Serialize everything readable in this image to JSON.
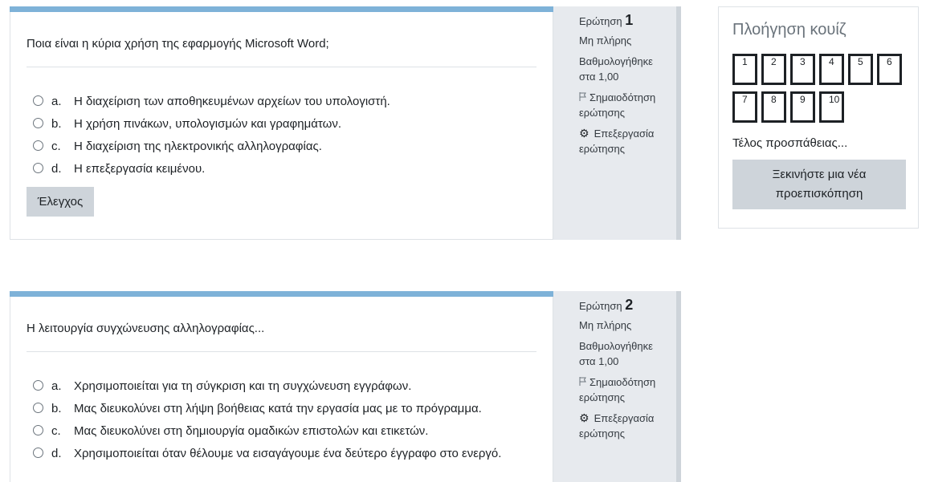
{
  "questions": [
    {
      "label": "Ερώτηση",
      "number": "1",
      "status": "Μη πλήρης",
      "grade_line1": "Βαθμολογήθηκε",
      "grade_line2": "στα 1,00",
      "flag_line1": "Σημαιοδότηση",
      "flag_line2": "ερώτησης",
      "edit_line1": "Επεξεργασία",
      "edit_line2": "ερώτησης",
      "text": "Ποια είναι η κύρια χρήση της εφαρμογής Microsoft Word;",
      "answers": [
        {
          "letter": "a.",
          "text": "Η διαχείριση των αποθηκευμένων αρχείων του υπολογιστή."
        },
        {
          "letter": "b.",
          "text": "Η χρήση πινάκων, υπολογισμών και γραφημάτων."
        },
        {
          "letter": "c.",
          "text": "Η διαχείριση της ηλεκτρονικής αλληλογραφίας."
        },
        {
          "letter": "d.",
          "text": "Η επεξεργασία κειμένου."
        }
      ],
      "check_label": "Έλεγχος"
    },
    {
      "label": "Ερώτηση",
      "number": "2",
      "status": "Μη πλήρης",
      "grade_line1": "Βαθμολογήθηκε",
      "grade_line2": "στα 1,00",
      "flag_line1": "Σημαιοδότηση",
      "flag_line2": "ερώτησης",
      "edit_line1": "Επεξεργασία",
      "edit_line2": "ερώτησης",
      "text": "Η λειτουργία συγχώνευσης αλληλογραφίας...",
      "answers": [
        {
          "letter": "a.",
          "text": "Χρησιμοποιείται για τη σύγκριση και τη συγχώνευση εγγράφων."
        },
        {
          "letter": "b.",
          "text": "Μας διευκολύνει στη λήψη βοήθειας κατά την εργασία μας με το πρόγραμμα."
        },
        {
          "letter": "c.",
          "text": "Μας διευκολύνει στη δημιουργία ομαδικών επιστολών και ετικετών."
        },
        {
          "letter": "d.",
          "text": "Χρησιμοποιείται όταν θέλουμε να εισαγάγουμε ένα δεύτερο έγγραφο στο ενεργό."
        }
      ]
    }
  ],
  "navigation": {
    "title": "Πλοήγηση κουίζ",
    "buttons": [
      "1",
      "2",
      "3",
      "4",
      "5",
      "6",
      "7",
      "8",
      "9",
      "10"
    ],
    "finish_label": "Τέλος προσπάθειας...",
    "restart_label": "Ξεκινήστε μια νέα προεπισκόπηση"
  },
  "colors": {
    "accent_bar": "#7eb2d8",
    "info_panel": "#e7eaee",
    "button_bg": "#ced4da"
  }
}
